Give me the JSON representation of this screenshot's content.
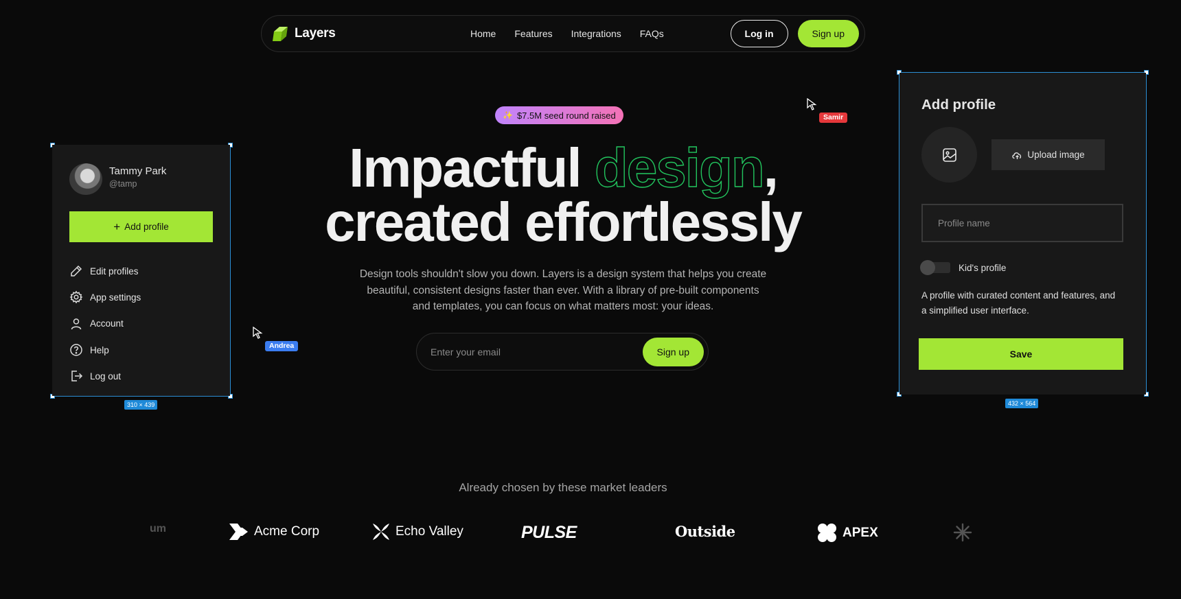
{
  "colors": {
    "accent": "#a3e635",
    "outline_green": "#22c55e",
    "selection": "#2b8fd6",
    "badge_from": "#c084fc",
    "badge_to": "#f472b6"
  },
  "nav": {
    "brand": "Layers",
    "links": [
      "Home",
      "Features",
      "Integrations",
      "FAQs"
    ],
    "login": "Log in",
    "signup": "Sign up"
  },
  "hero": {
    "badge_icon": "✨",
    "badge": "$7.5M seed round raised",
    "line1_a": "Impactful",
    "line1_b": "design",
    "line1_c": ",",
    "line2": "created effortlessly",
    "sub": "Design tools shouldn't slow you down. Layers is a design system that helps you create beautiful, consistent designs faster than ever. With a library of pre-built components and templates, you can focus on what matters most: your ideas.",
    "email_placeholder": "Enter your email",
    "email_button": "Sign up"
  },
  "left_card": {
    "dims": "310 × 439",
    "name": "Tammy Park",
    "handle": "@tamp",
    "add_profile": "Add profile",
    "menu": [
      {
        "label": "Edit profiles",
        "icon": "pencil-icon"
      },
      {
        "label": "App settings",
        "icon": "gear-icon"
      },
      {
        "label": "Account",
        "icon": "user-icon"
      },
      {
        "label": "Help",
        "icon": "help-circle-icon"
      },
      {
        "label": "Log out",
        "icon": "logout-icon"
      }
    ]
  },
  "right_card": {
    "dims": "432 × 564",
    "title": "Add profile",
    "upload": "Upload image",
    "profile_name_placeholder": "Profile name",
    "kids_profile": "Kid's profile",
    "description": "A profile with curated content and features, and a simplified user interface.",
    "save": "Save"
  },
  "cursors": [
    {
      "name": "Andrea",
      "color": "#3b7df0"
    },
    {
      "name": "Samir",
      "color": "#e5383b"
    }
  ],
  "logos": {
    "heading": "Already chosen by these market leaders",
    "items": [
      "um",
      "Acme Corp",
      "Echo Valley",
      "PULSE",
      "Outside",
      "APEX"
    ]
  }
}
